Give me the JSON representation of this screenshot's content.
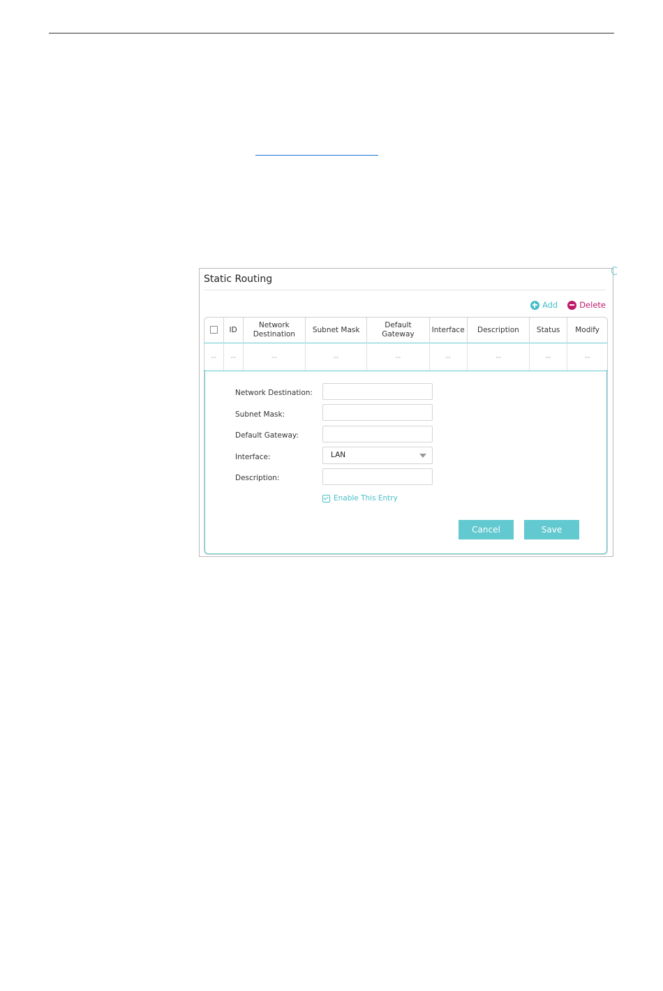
{
  "panel": {
    "title": "Static Routing"
  },
  "toolbar": {
    "add_label": "Add",
    "delete_label": "Delete"
  },
  "table": {
    "columns": [
      "ID",
      "Network Destination",
      "Subnet Mask",
      "Default Gateway",
      "Interface",
      "Description",
      "Status",
      "Modify"
    ],
    "row": [
      "--",
      "--",
      "--",
      "--",
      "--",
      "--",
      "--",
      "--",
      "--"
    ]
  },
  "form": {
    "network_destination_label": "Network Destination:",
    "subnet_mask_label": "Subnet Mask:",
    "default_gateway_label": "Default Gateway:",
    "interface_label": "Interface:",
    "interface_value": "LAN",
    "description_label": "Description:",
    "enable_label": "Enable This Entry",
    "enable_checked": true,
    "cancel_label": "Cancel",
    "save_label": "Save"
  },
  "colors": {
    "accent": "#62c9d1",
    "delete": "#c0186b"
  }
}
